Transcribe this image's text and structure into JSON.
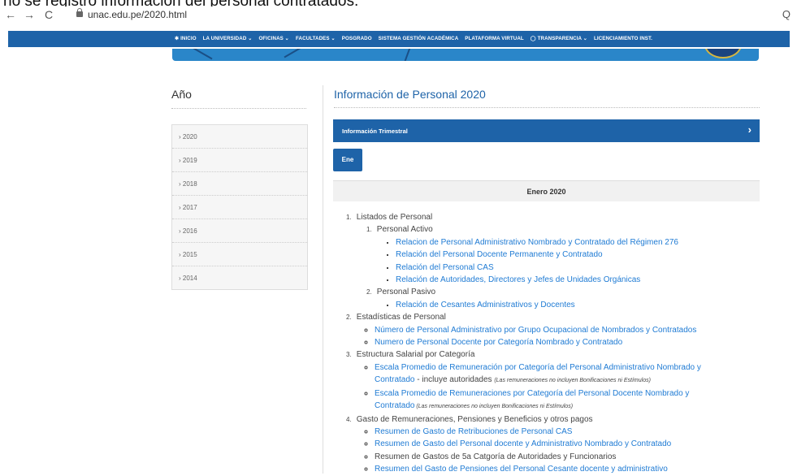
{
  "caption": "no se registro información del personal contratados.",
  "browser": {
    "back": "←",
    "forward": "→",
    "reload": "C",
    "url": "unac.edu.pe/2020.html",
    "zoom_icon": "Q"
  },
  "nav": [
    "✱ INICIO",
    "LA UNIVERSIDAD ⌄",
    "OFICINAS ⌄",
    "FACULTADES ⌄",
    "POSGRADO",
    "SISTEMA GESTIÓN ACADÉMICA",
    "PLATAFORMA VIRTUAL",
    "◯ TRANSPARENCIA ⌄",
    "LICENCIAMIENTO INST."
  ],
  "sidebar": {
    "title": "Año",
    "years": [
      "› 2020",
      "› 2019",
      "› 2018",
      "› 2017",
      "› 2016",
      "› 2015",
      "› 2014"
    ]
  },
  "main": {
    "title": "Información de Personal 2020",
    "accordion": "Información Trimestral",
    "accordion_icon": "›",
    "tab": "Ene",
    "month": "Enero 2020"
  },
  "content": {
    "s1": {
      "num": "1.",
      "label": "Listados de Personal",
      "a": {
        "num": "1.",
        "label": "Personal Activo",
        "links": [
          "Relacion de Personal Administrativo Nombrado y Contratado del Régimen 276",
          "Relación del Personal Docente Permanente y Contratado",
          "Relación del Personal CAS",
          "Relación de Autoridades, Directores y Jefes de Unidades Orgánicas"
        ]
      },
      "b": {
        "num": "2.",
        "label": "Personal Pasivo",
        "links": [
          "Relación de Cesantes Administrativos y Docentes"
        ]
      }
    },
    "s2": {
      "num": "2.",
      "label": "Estadísticas de Personal",
      "links": [
        "Número de Personal Administrativo por Grupo Ocupacional de Nombrados y Contratados",
        "Numero de Personal Docente por Categoría Nombrado y Contratado"
      ]
    },
    "s3": {
      "num": "3.",
      "label": "Estructura Salarial por Categoría",
      "l1a": "Escala Promedio de Remuneración por Categoría del Personal Administrativo Nombrado y",
      "l1b": "Contratado",
      "l1c": " - incluye autoridades ",
      "l1note": "(Las remuneraciones no incluyen Bonificaciones ni Estímulos)",
      "l2a": "Escala Promedio de Remuneraciones por Categoría del Personal Docente Nombrado y",
      "l2b": "Contratado",
      "l2note": " (Las remuneraciones no incluyen Bonificaciones ni Estímulos)"
    },
    "s4": {
      "num": "4.",
      "label": "Gasto de Remuneraciones, Pensiones y Beneficios y otros pagos",
      "items": [
        "Resumen de Gasto de Retribuciones de Personal CAS",
        "Resumen de Gasto del Personal docente y Administrativo Nombrado y Contratado",
        "Resumen de Gastos de 5a Catgoría de Autoridades y Funcionarios",
        "Resumen del Gasto de Pensiones del Personal Cesante docente y administrativo"
      ]
    }
  }
}
